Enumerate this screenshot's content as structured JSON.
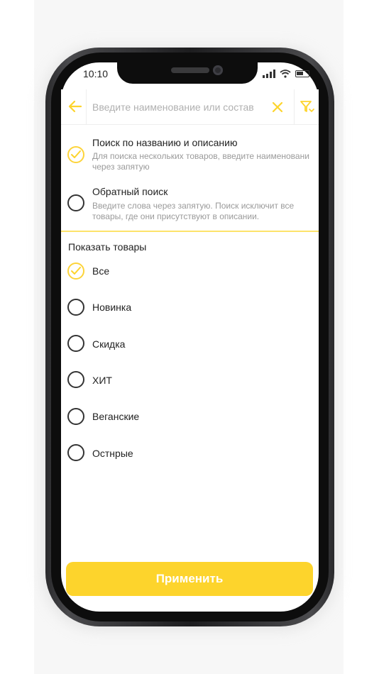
{
  "status_bar": {
    "time": "10:10"
  },
  "search": {
    "placeholder": "Введите наименование или состав"
  },
  "search_modes": [
    {
      "title": "Поиск по названию и описанию",
      "description_line1": "Для поиска нескольких товаров, введите наименовани",
      "description_line2": "через запятую",
      "checked": true
    },
    {
      "title": "Обратный поиск",
      "description_line1": "Введите слова через запятую. Поиск исключит все",
      "description_line2": "товары, где они присутствуют в описании.",
      "checked": false
    }
  ],
  "show_products": {
    "title": "Показать товары",
    "items": [
      {
        "label": "Все",
        "checked": true
      },
      {
        "label": "Новинка",
        "checked": false
      },
      {
        "label": "Скидка",
        "checked": false
      },
      {
        "label": "ХИТ",
        "checked": false
      },
      {
        "label": "Веганские",
        "checked": false
      },
      {
        "label": "Остнрые",
        "checked": false
      }
    ]
  },
  "apply_button": {
    "label": "Применить"
  },
  "colors": {
    "accent": "#fdd42c",
    "accent_line": "#fde36a",
    "text": "#222222",
    "muted": "#9a9a9a"
  },
  "icons": {
    "back": "arrow-left-icon",
    "clear": "close-icon",
    "filter": "filter-icon",
    "check": "check-icon"
  }
}
